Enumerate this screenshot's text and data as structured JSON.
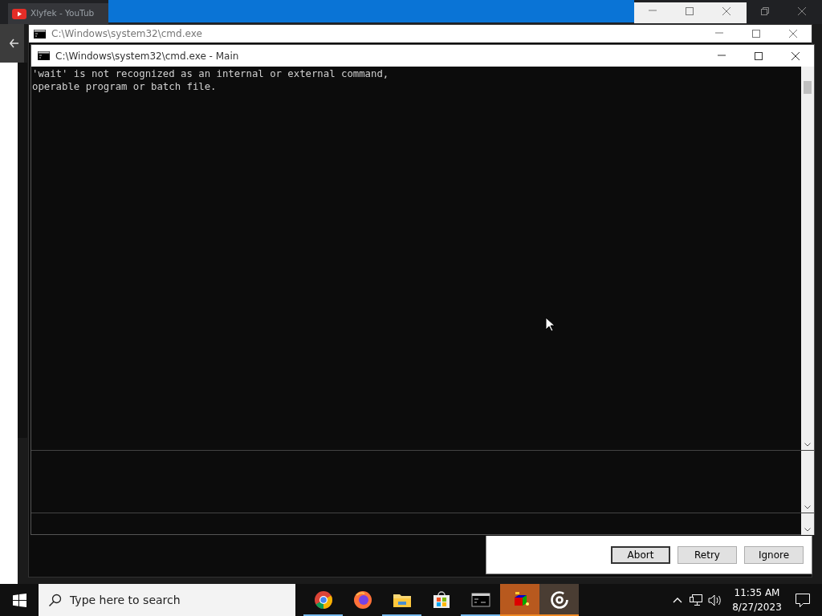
{
  "browser_tab": {
    "title": "Xlyfek - YouTub"
  },
  "back_window": {
    "title": "C:\\Windows\\system32\\cmd.exe"
  },
  "main_window": {
    "title": "C:\\Windows\\system32\\cmd.exe - Main",
    "output": [
      "'wait' is not recognized as an internal or external command,",
      "operable program or batch file."
    ]
  },
  "dialog": {
    "buttons": [
      {
        "label": "Abort",
        "selected": true
      },
      {
        "label": "Retry",
        "selected": false
      },
      {
        "label": "Ignore",
        "selected": false
      }
    ]
  },
  "taskbar": {
    "search_placeholder": "Type here to search",
    "apps": [
      {
        "kind": "chrome",
        "running": true,
        "flashing": false,
        "active": false
      },
      {
        "kind": "firefox",
        "running": false,
        "flashing": false,
        "active": false
      },
      {
        "kind": "explorer",
        "running": true,
        "flashing": false,
        "active": false
      },
      {
        "kind": "store",
        "running": false,
        "flashing": false,
        "active": false
      },
      {
        "kind": "console",
        "running": true,
        "flashing": false,
        "active": false
      },
      {
        "kind": "cube",
        "running": true,
        "flashing": true,
        "active": false
      },
      {
        "kind": "target",
        "running": true,
        "flashing": false,
        "active": true
      }
    ],
    "time": "11:35 AM",
    "date": "8/27/2023"
  }
}
